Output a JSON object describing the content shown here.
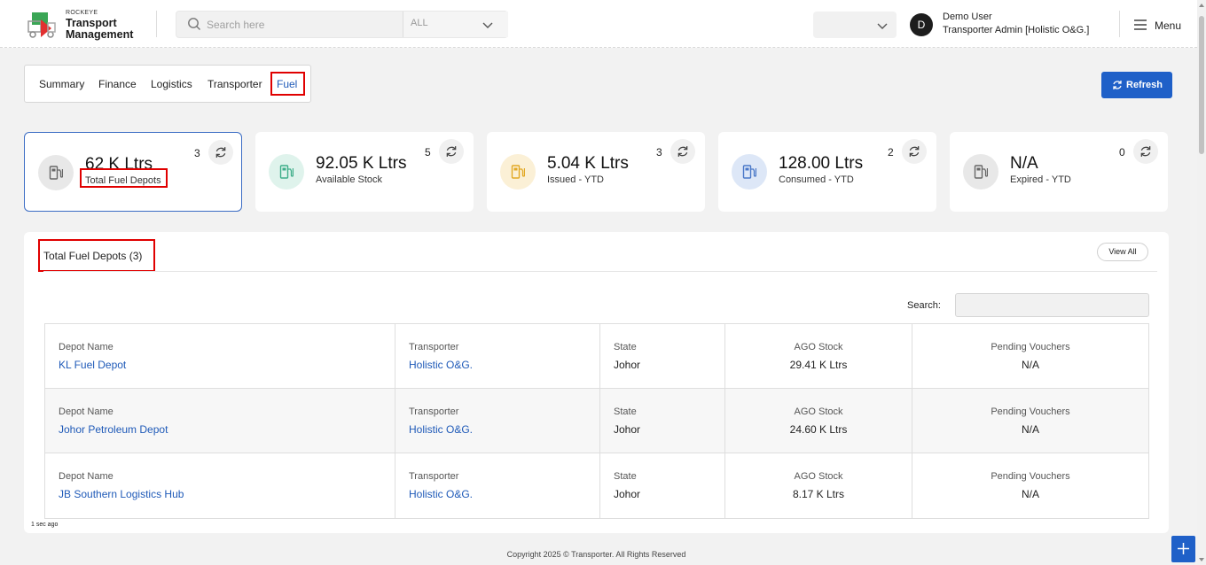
{
  "header": {
    "brand_small": "ROCKEYE",
    "brand_line1": "Transport",
    "brand_line2": "Management",
    "search_placeholder": "Search here",
    "search_scope": "ALL",
    "avatar_initial": "D",
    "user_name": "Demo User",
    "user_role": "Transporter Admin [Holistic O&G.]",
    "menu_label": "Menu"
  },
  "tabs": [
    {
      "label": "Summary"
    },
    {
      "label": "Finance"
    },
    {
      "label": "Logistics"
    },
    {
      "label": "Transporter"
    },
    {
      "label": "Fuel"
    }
  ],
  "refresh_label": "Refresh",
  "cards": [
    {
      "value": "62 K Ltrs",
      "label": "Total Fuel Depots",
      "count": "3",
      "icon": "fuel-pump-icon",
      "color": "#e8e8e8",
      "icon_color": "#666666"
    },
    {
      "value": "92.05 K Ltrs",
      "label": "Available Stock",
      "count": "5",
      "icon": "fuel-pump-icon",
      "color": "#dff3ec",
      "icon_color": "#3fae8a"
    },
    {
      "value": "5.04 K Ltrs",
      "label": "Issued - YTD",
      "count": "3",
      "icon": "fuel-pump-icon",
      "color": "#fbf0d6",
      "icon_color": "#e2a824"
    },
    {
      "value": "128.00 Ltrs",
      "label": "Consumed - YTD",
      "count": "2",
      "icon": "fuel-pump-icon",
      "color": "#dde7f7",
      "icon_color": "#4a78c8"
    },
    {
      "value": "N/A",
      "label": "Expired - YTD",
      "count": "0",
      "icon": "fuel-pump-icon",
      "color": "#e8e8e8",
      "icon_color": "#666666"
    }
  ],
  "panel": {
    "title": "Total Fuel Depots (3)",
    "view_all": "View All",
    "search_label": "Search:",
    "columns": [
      "Depot Name",
      "Transporter",
      "State",
      "AGO Stock",
      "Pending Vouchers"
    ],
    "rows": [
      {
        "depot": "KL Fuel Depot",
        "transporter": "Holistic O&G.",
        "state": "Johor",
        "ago": "29.41 K Ltrs",
        "pending": "N/A"
      },
      {
        "depot": "Johor Petroleum Depot",
        "transporter": "Holistic O&G.",
        "state": "Johor",
        "ago": "24.60 K Ltrs",
        "pending": "N/A"
      },
      {
        "depot": "JB Southern Logistics Hub",
        "transporter": "Holistic O&G.",
        "state": "Johor",
        "ago": "8.17 K Ltrs",
        "pending": "N/A"
      }
    ]
  },
  "updated": "1 sec ago",
  "footer": "Copyright 2025 © Transporter. All Rights Reserved"
}
